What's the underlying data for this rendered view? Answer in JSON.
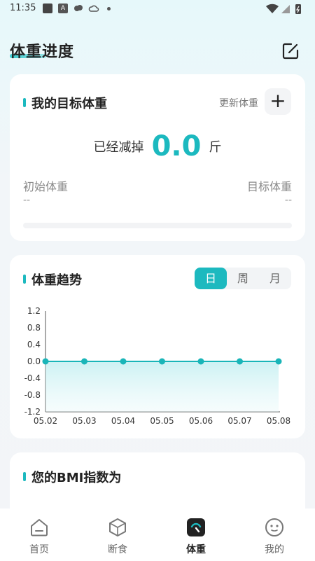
{
  "status_bar": {
    "time": "11:35",
    "notification_a": "A"
  },
  "header": {
    "title": "体重进度"
  },
  "goal_card": {
    "title": "我的目标体重",
    "update_label": "更新体重",
    "add_symbol": "+",
    "lost_prefix": "已经减掉",
    "lost_value": "0.0",
    "lost_unit": "斤",
    "initial_label": "初始体重",
    "initial_value": "--",
    "target_label": "目标体重",
    "target_value": "--",
    "progress": 0
  },
  "trend_card": {
    "title": "体重趋势",
    "tabs": [
      "日",
      "周",
      "月"
    ],
    "active_tab": 0
  },
  "chart_data": {
    "type": "line",
    "x": [
      "05.02",
      "05.03",
      "05.04",
      "05.05",
      "05.06",
      "05.07",
      "05.08"
    ],
    "series": [
      {
        "values": [
          0,
          0,
          0,
          0,
          0,
          0,
          0
        ]
      }
    ],
    "yticks": [
      "1.2",
      "0.8",
      "0.4",
      "0.0",
      "-0.4",
      "-0.8",
      "-1.2"
    ],
    "ylim": [
      -1.2,
      1.2
    ],
    "grid": false
  },
  "bmi_card": {
    "title": "您的BMI指数为"
  },
  "nav": {
    "items": [
      {
        "label": "首页",
        "icon": "home-icon"
      },
      {
        "label": "断食",
        "icon": "box-icon"
      },
      {
        "label": "体重",
        "icon": "scale-icon"
      },
      {
        "label": "我的",
        "icon": "face-icon"
      }
    ],
    "active": 2
  },
  "colors": {
    "accent": "#1cb9bf",
    "line": "#19b5b8"
  }
}
